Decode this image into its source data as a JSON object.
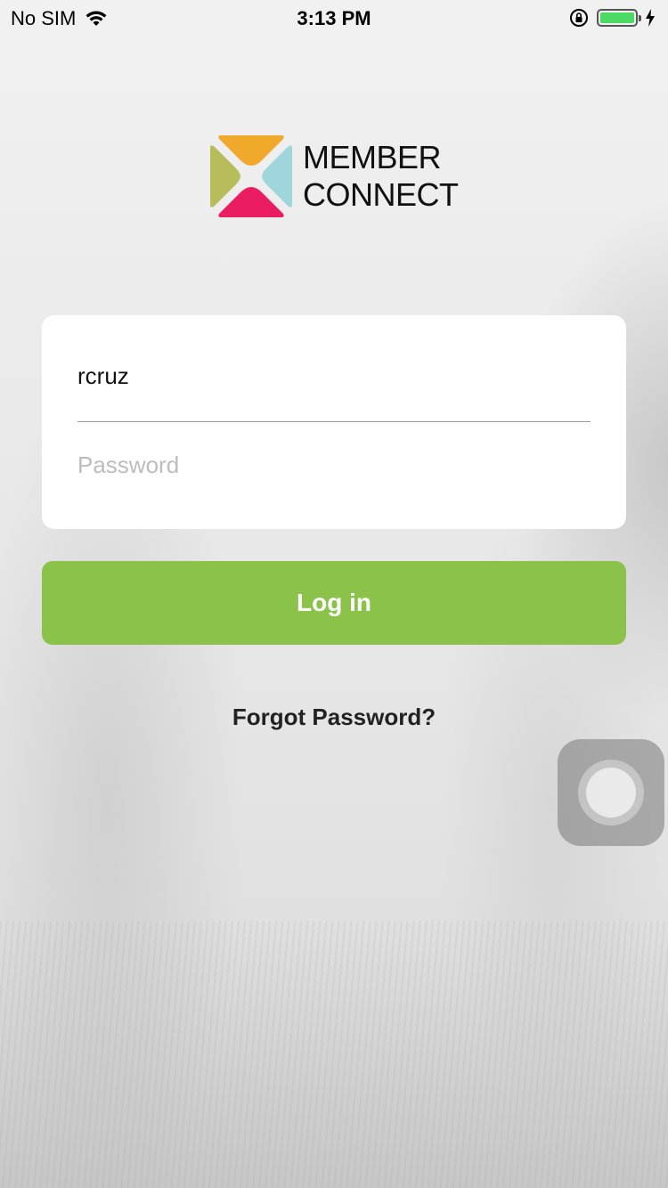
{
  "status_bar": {
    "carrier": "No SIM",
    "time": "3:13 PM",
    "icons": [
      "wifi-icon",
      "orientation-lock-icon",
      "battery-icon",
      "charging-icon"
    ]
  },
  "logo": {
    "line1": "MEMBER",
    "line2": "CONNECT",
    "colors": {
      "top": "#f0a92a",
      "left": "#b7bd5a",
      "right": "#9fd6dc",
      "bottom": "#ea1d63"
    }
  },
  "login_form": {
    "username_value": "rcruz",
    "password_placeholder": "Password",
    "login_label": "Log in",
    "forgot_label": "Forgot Password?"
  },
  "colors": {
    "accent": "#8bc34a",
    "battery": "#4cd964"
  }
}
